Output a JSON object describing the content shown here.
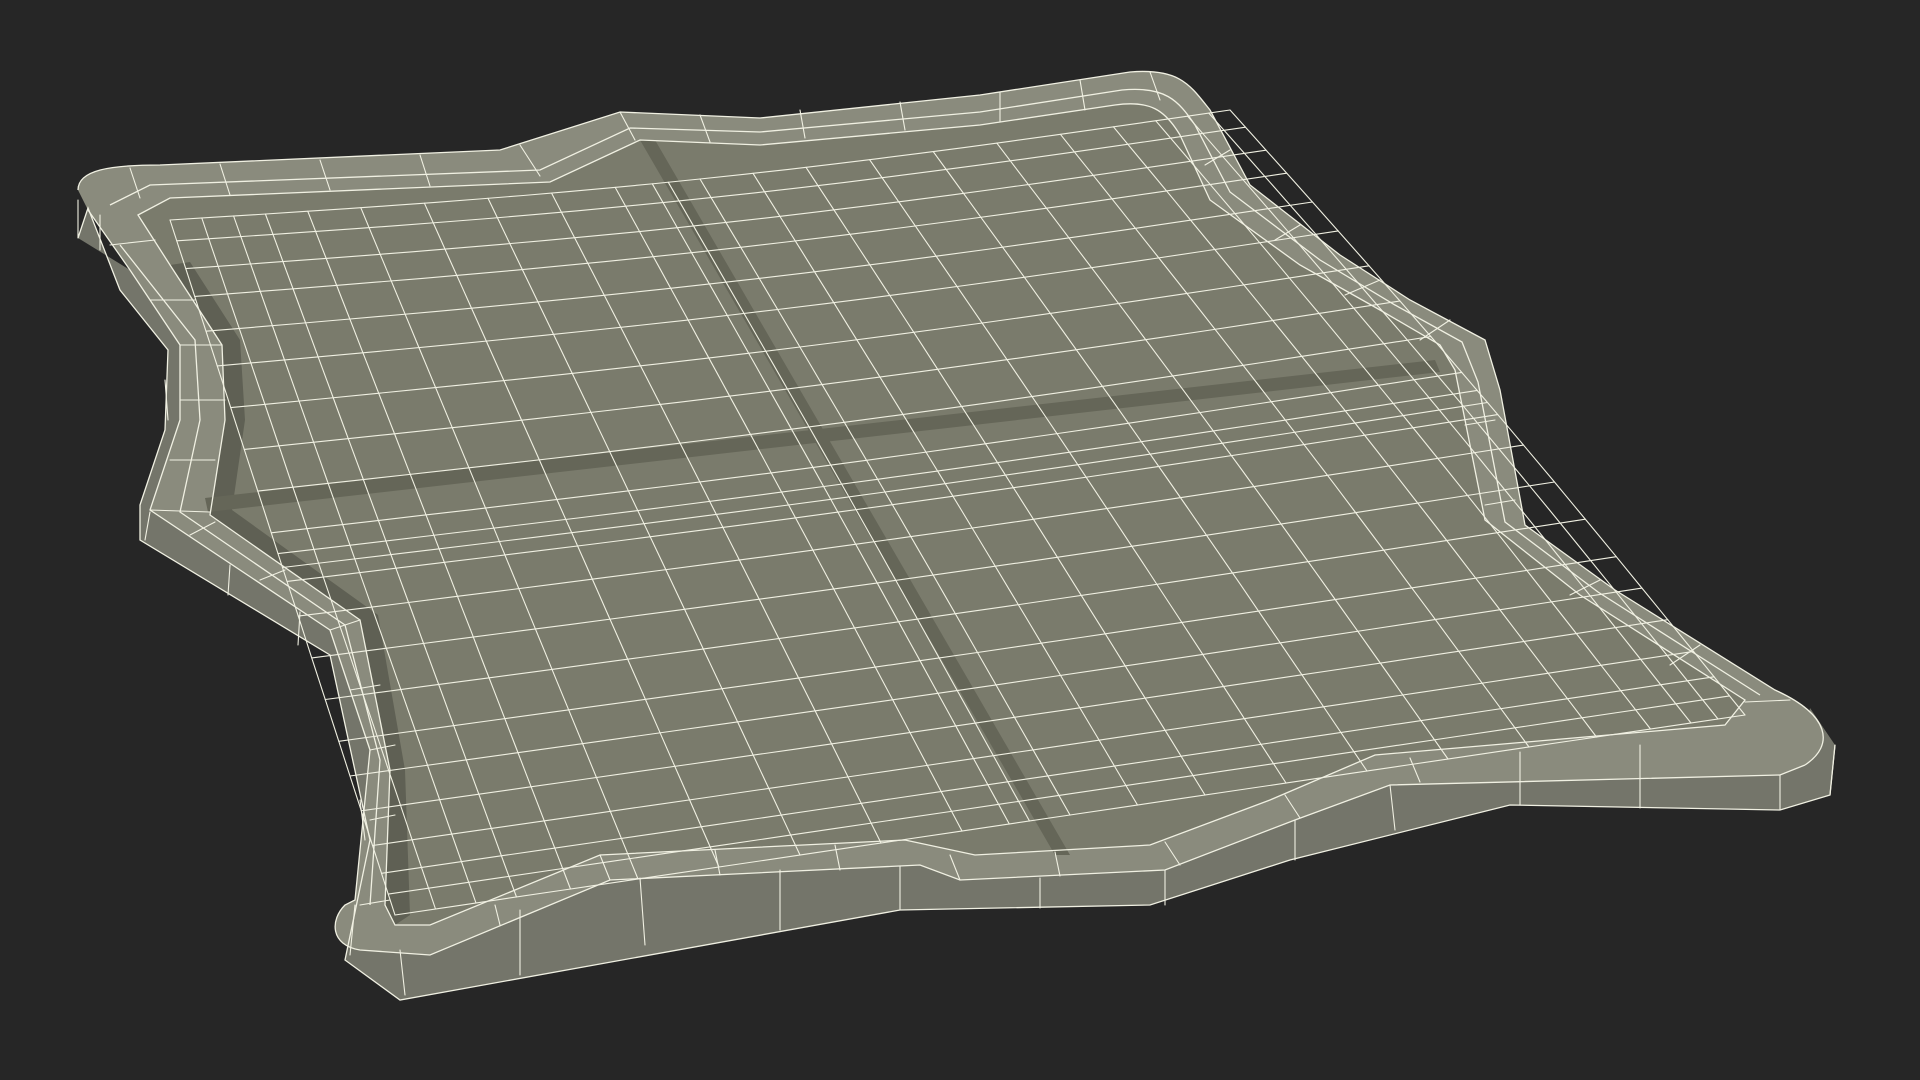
{
  "scene": {
    "subject": "wireframe-mesh",
    "colors": {
      "background": "#262626",
      "rim_face": "#8b8c7e",
      "rim_side": "#777869",
      "floor": "#7b7c6d",
      "groove": "#626356",
      "wire": "#f0f0e2"
    }
  }
}
